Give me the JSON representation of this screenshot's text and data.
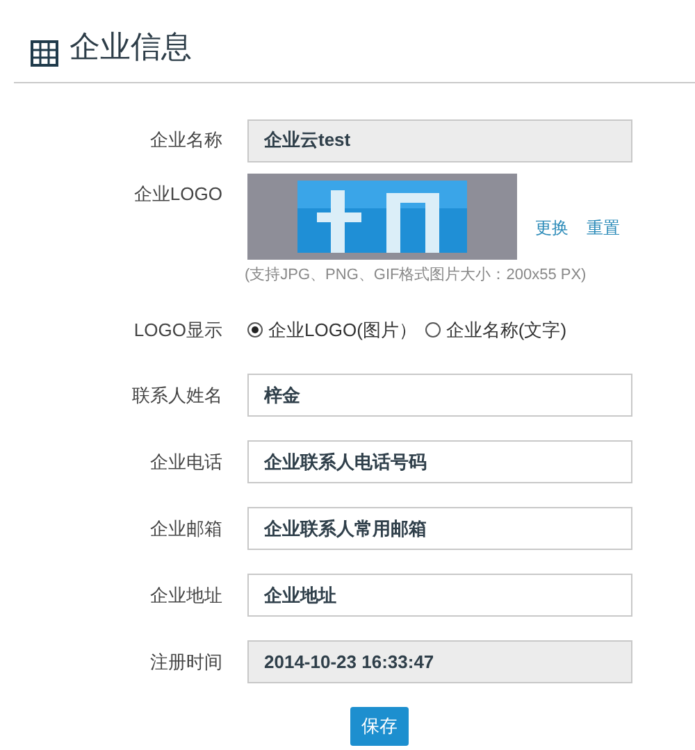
{
  "title": "企业信息",
  "company_name": {
    "label": "企业名称",
    "value": "企业云test",
    "disabled": true
  },
  "logo": {
    "label": "企业LOGO",
    "links": [
      "更换",
      "重置"
    ],
    "hint": "(支持JPG、PNG、GIF格式图片大小：200x55 PX)"
  },
  "logo_display": {
    "label": "LOGO显示",
    "options": [
      {
        "label": "企业LOGO(图片）",
        "selected": true
      },
      {
        "label": "企业名称(文字)",
        "selected": false
      }
    ]
  },
  "fields": [
    {
      "label": "联系人姓名",
      "value": "梓金",
      "disabled": false
    },
    {
      "label": "企业电话",
      "value": "企业联系人电话号码",
      "disabled": false
    },
    {
      "label": "企业邮箱",
      "value": "企业联系人常用邮箱",
      "disabled": false
    },
    {
      "label": "企业地址",
      "value": "企业地址",
      "disabled": false
    },
    {
      "label": "注册时间",
      "value": "2014-10-23 16:33:47",
      "disabled": true
    }
  ],
  "save_button": "保存"
}
